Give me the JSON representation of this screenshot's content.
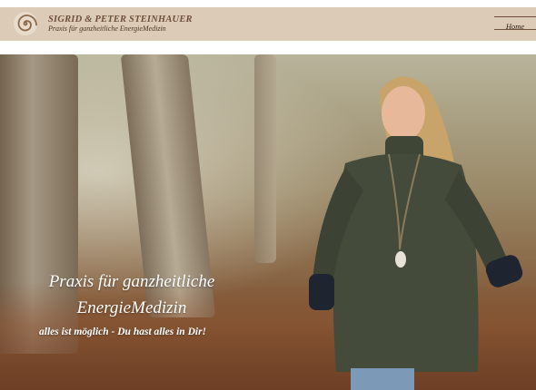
{
  "header": {
    "name": "SIGRID & PETER STEINHAUER",
    "subtitle": "Praxis für ganzheitliche EnergieMedizin",
    "logo_icon": "spiral-logo-icon"
  },
  "nav": {
    "home_label": "Home"
  },
  "hero": {
    "title_line1": "Praxis für ganzheitliche",
    "title_line2": "EnergieMedizin",
    "tagline": "alles ist möglich - Du hast alles in Dir!",
    "photo_icon": "woman-walking-in-forest-photo"
  },
  "colors": {
    "header_bg": "#dccbb7",
    "brand_text": "#6e4f3a",
    "hero_text": "#ffffff"
  }
}
